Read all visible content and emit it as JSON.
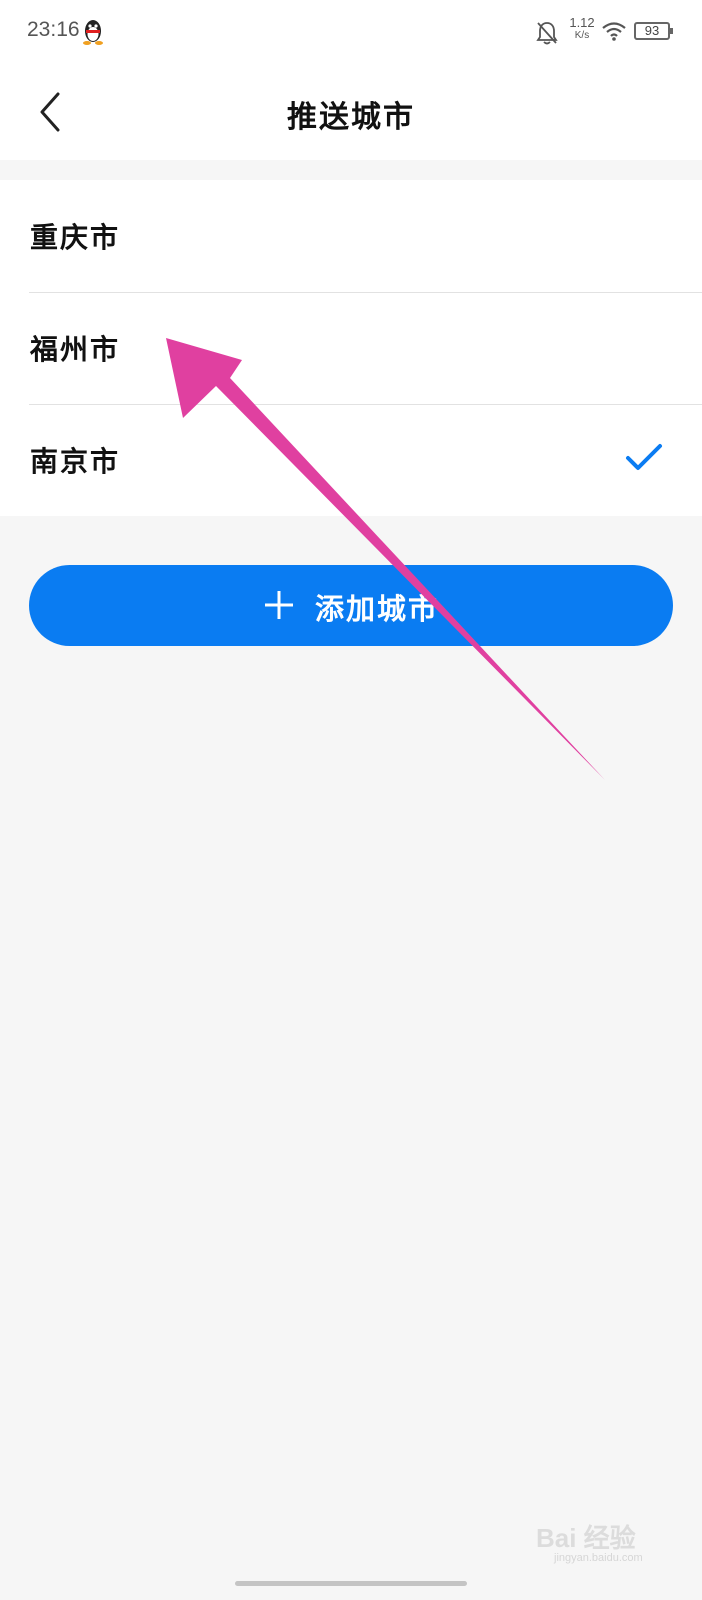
{
  "status_bar": {
    "time": "23:16",
    "net_speed_value": "1.12",
    "net_speed_unit": "K/s",
    "battery": "93",
    "icons": [
      "qq-icon",
      "bell-muted-icon",
      "wifi-icon",
      "battery-icon"
    ]
  },
  "header": {
    "title": "推送城市",
    "back_icon": "back-chevron-icon"
  },
  "cities": [
    {
      "name": "重庆市",
      "selected": false
    },
    {
      "name": "福州市",
      "selected": false
    },
    {
      "name": "南京市",
      "selected": true
    }
  ],
  "add_button": {
    "label": "添加城市",
    "icon": "plus-icon"
  },
  "annotation": {
    "type": "arrow",
    "color": "#e040a0"
  },
  "watermark": {
    "brand": "Bai 经验",
    "url": "jingyan.baidu.com"
  },
  "colors": {
    "accent": "#0a7cf2",
    "check": "#0a7cf2",
    "annotation_arrow": "#e040a0"
  }
}
